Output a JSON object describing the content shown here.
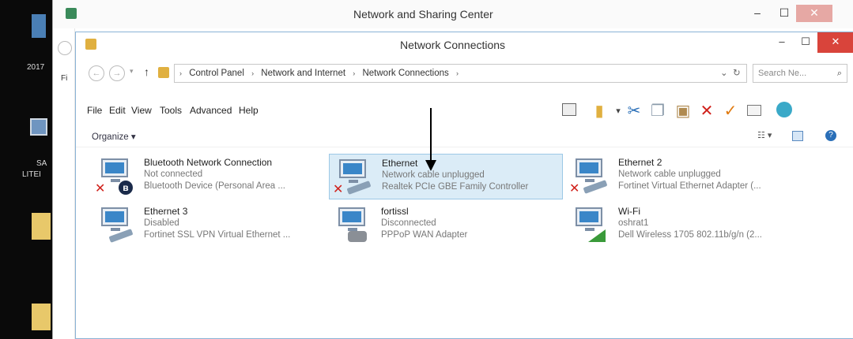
{
  "desktop": {
    "texts": [
      "2017",
      "Fi",
      "SA",
      "LITEI"
    ]
  },
  "back_window": {
    "title": "Network and Sharing Center",
    "min_label": "–",
    "max_label": "☐",
    "close_label": "✕"
  },
  "window": {
    "title": "Network Connections",
    "min_label": "–",
    "max_label": "☐",
    "close_label": "✕"
  },
  "nav": {
    "back_label": "←",
    "forward_label": "→",
    "up_label": "↑",
    "dropdown_label": "⌄",
    "refresh_label": "↻"
  },
  "address": {
    "crumbs": [
      "Control Panel",
      "Network and Internet",
      "Network Connections"
    ],
    "separator": "›"
  },
  "search": {
    "placeholder": "Search Ne...",
    "icon": "search-icon"
  },
  "menu": [
    "File",
    "Edit",
    "View",
    "Tools",
    "Advanced",
    "Help"
  ],
  "toolbar": {
    "organize_label": "Organize ▾",
    "icons": [
      "view-pane-icon",
      "folder-icon",
      "cut-icon",
      "copy-icon",
      "paste-icon",
      "delete-icon",
      "check-icon",
      "rename-icon",
      "network-globe-icon"
    ]
  },
  "view_controls": {
    "change_view": "☷ ▾",
    "preview": "▭",
    "help": "?"
  },
  "connections": [
    {
      "name": "Bluetooth Network Connection",
      "status": "Not connected",
      "device": "Bluetooth Device (Personal Area ...",
      "badge": "bluetooth-icon",
      "error": true,
      "selected": false
    },
    {
      "name": "Ethernet",
      "status": "Network cable unplugged",
      "device": "Realtek PCIe GBE Family Controller",
      "badge": "cable-icon",
      "error": true,
      "selected": true
    },
    {
      "name": "Ethernet 2",
      "status": "Network cable unplugged",
      "device": "Fortinet Virtual Ethernet Adapter (...",
      "badge": "cable-icon",
      "error": true,
      "selected": false
    },
    {
      "name": "Ethernet 3",
      "status": "Disabled",
      "device": "Fortinet SSL VPN Virtual Ethernet ...",
      "badge": "cable-icon",
      "error": false,
      "selected": false
    },
    {
      "name": "fortissl",
      "status": "Disconnected",
      "device": "PPPoP WAN Adapter",
      "badge": "phone-icon",
      "error": false,
      "selected": false
    },
    {
      "name": "Wi-Fi",
      "status": "oshrat1",
      "device": "Dell Wireless 1705 802.11b/g/n (2...",
      "badge": "signal-bars-icon",
      "error": false,
      "selected": false
    }
  ],
  "colors": {
    "close": "#d9443b",
    "selection": "#dbecf7",
    "error_x": "#d0201a",
    "monitor": "#3a86c8"
  }
}
